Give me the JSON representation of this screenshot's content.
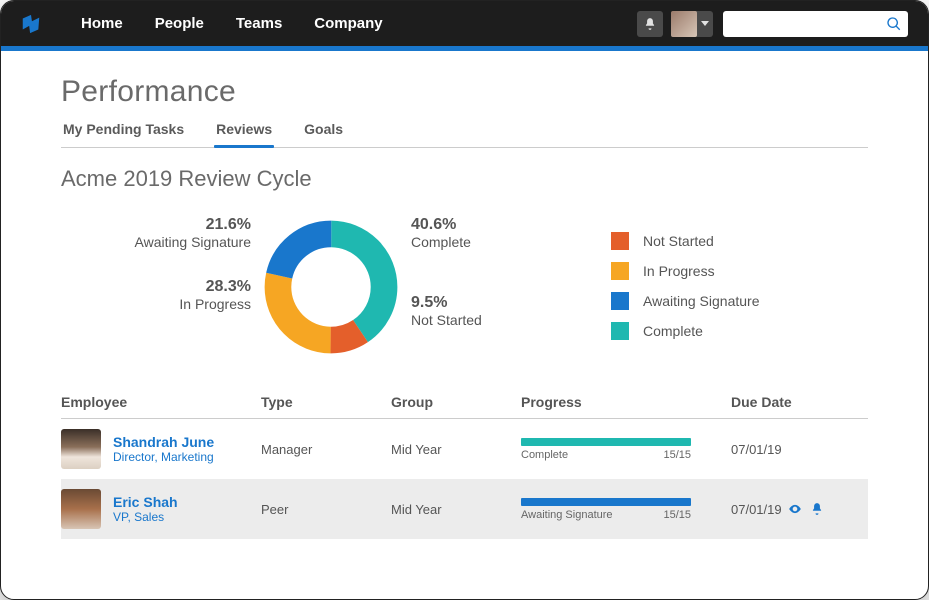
{
  "nav": {
    "items": [
      "Home",
      "People",
      "Teams",
      "Company"
    ]
  },
  "search": {
    "placeholder": ""
  },
  "page": {
    "title": "Performance"
  },
  "tabs": [
    {
      "label": "My Pending Tasks",
      "active": false
    },
    {
      "label": "Reviews",
      "active": true
    },
    {
      "label": "Goals",
      "active": false
    }
  ],
  "section": {
    "title": "Acme 2019 Review Cycle"
  },
  "chart_data": {
    "type": "pie",
    "title": "Acme 2019 Review Cycle",
    "series": [
      {
        "name": "Not Started",
        "value": 9.5,
        "color": "#e45f2b"
      },
      {
        "name": "In Progress",
        "value": 28.3,
        "color": "#f6a623"
      },
      {
        "name": "Awaiting Signature",
        "value": 21.6,
        "color": "#1977cc"
      },
      {
        "name": "Complete",
        "value": 40.6,
        "color": "#1fb8b0"
      }
    ],
    "callouts": {
      "awaiting": {
        "pct": "21.6%",
        "label": "Awaiting Signature"
      },
      "inprogress": {
        "pct": "28.3%",
        "label": "In Progress"
      },
      "complete": {
        "pct": "40.6%",
        "label": "Complete"
      },
      "notstarted": {
        "pct": "9.5%",
        "label": "Not Started"
      }
    },
    "legend": [
      "Not Started",
      "In Progress",
      "Awaiting Signature",
      "Complete"
    ]
  },
  "table": {
    "headers": {
      "employee": "Employee",
      "type": "Type",
      "group": "Group",
      "progress": "Progress",
      "due": "Due Date"
    },
    "rows": [
      {
        "name": "Shandrah June",
        "role": "Director, Marketing",
        "type": "Manager",
        "group": "Mid Year",
        "progress": {
          "status": "Complete",
          "count": "15/15",
          "pct": 100,
          "color": "#1fb8b0"
        },
        "due": "07/01/19",
        "icons": false
      },
      {
        "name": "Eric Shah",
        "role": "VP, Sales",
        "type": "Peer",
        "group": "Mid Year",
        "progress": {
          "status": "Awaiting Signature",
          "count": "15/15",
          "pct": 100,
          "color": "#1977cc"
        },
        "due": "07/01/19",
        "icons": true
      }
    ]
  }
}
